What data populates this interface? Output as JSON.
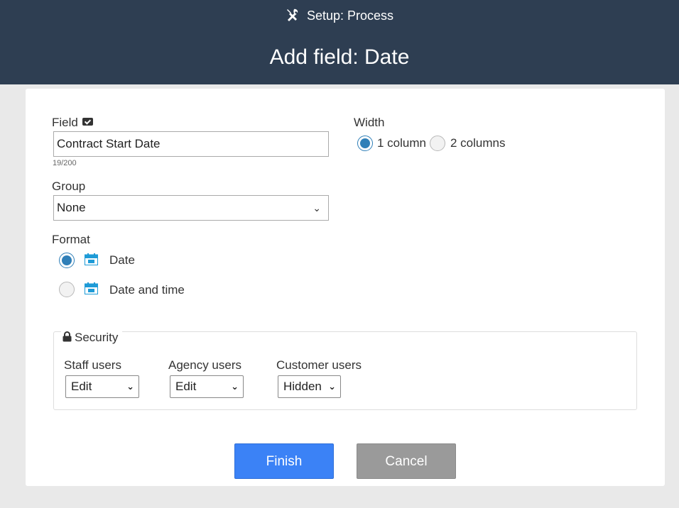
{
  "header": {
    "setup_label": "Setup: Process",
    "title": "Add field: Date",
    "icon": "tools-icon"
  },
  "form": {
    "field": {
      "label": "Field",
      "value": "Contract Start Date",
      "counter": "19/200"
    },
    "group": {
      "label": "Group",
      "selected": "None"
    },
    "width": {
      "label": "Width",
      "options": [
        {
          "label": "1 column",
          "selected": true
        },
        {
          "label": "2 columns",
          "selected": false
        }
      ]
    },
    "format": {
      "label": "Format",
      "options": [
        {
          "label": "Date",
          "selected": true
        },
        {
          "label": "Date and time",
          "selected": false
        }
      ]
    },
    "security": {
      "legend": "Security",
      "staff": {
        "label": "Staff users",
        "selected": "Edit"
      },
      "agency": {
        "label": "Agency users",
        "selected": "Edit"
      },
      "customer": {
        "label": "Customer users",
        "selected": "Hidden"
      }
    }
  },
  "buttons": {
    "finish": "Finish",
    "cancel": "Cancel"
  },
  "colors": {
    "header_bg": "#2e3e52",
    "primary": "#3b82f6",
    "secondary": "#9a9a9a",
    "radio_selected": "#2f7fb8"
  }
}
